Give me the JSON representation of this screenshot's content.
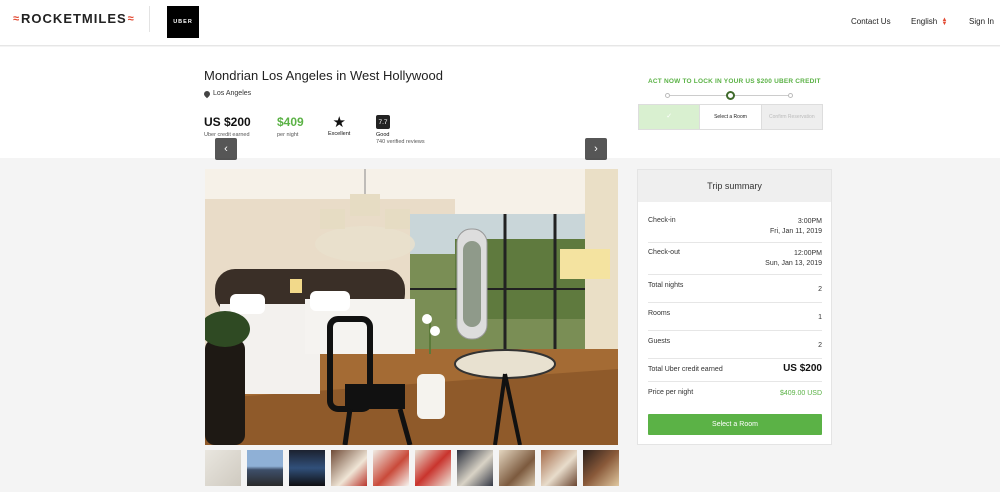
{
  "header": {
    "logo_text": "ROCKETMILES",
    "partner_logo_text": "UBER",
    "nav": {
      "contact": "Contact Us",
      "language": "English",
      "signin": "Sign In"
    }
  },
  "hotel": {
    "name": "Mondrian Los Angeles in West Hollywood",
    "location": "Los Angeles",
    "stats": {
      "credit_value": "US $200",
      "credit_label": "Uber credit earned",
      "price_value": "$409",
      "price_label": "per night",
      "class_label": "Excellent",
      "rating_value": "7.7",
      "rating_label": "Good",
      "reviews": "740 verified reviews"
    }
  },
  "progress": {
    "headline": "ACT NOW TO LOCK IN YOUR US $200 UBER CREDIT",
    "steps": [
      "✓",
      "Select a Room",
      "Confirm Reservation"
    ]
  },
  "gallery": {
    "prev_icon": "‹",
    "next_icon": "›",
    "thumbnail_count": 10
  },
  "summary": {
    "title": "Trip summary",
    "checkin_label": "Check-in",
    "checkin_time": "3:00PM",
    "checkin_date": "Fri, Jan 11, 2019",
    "checkout_label": "Check-out",
    "checkout_time": "12:00PM",
    "checkout_date": "Sun, Jan 13, 2019",
    "nights_label": "Total nights",
    "nights": "2",
    "rooms_label": "Rooms",
    "rooms": "1",
    "guests_label": "Guests",
    "guests": "2",
    "credit_label": "Total Uber credit earned",
    "credit": "US $200",
    "price_label": "Price per night",
    "price": "$409.00 USD",
    "button": "Select a Room"
  },
  "colors": {
    "accent_green": "#5bb246",
    "brand_red": "#e24a33"
  }
}
